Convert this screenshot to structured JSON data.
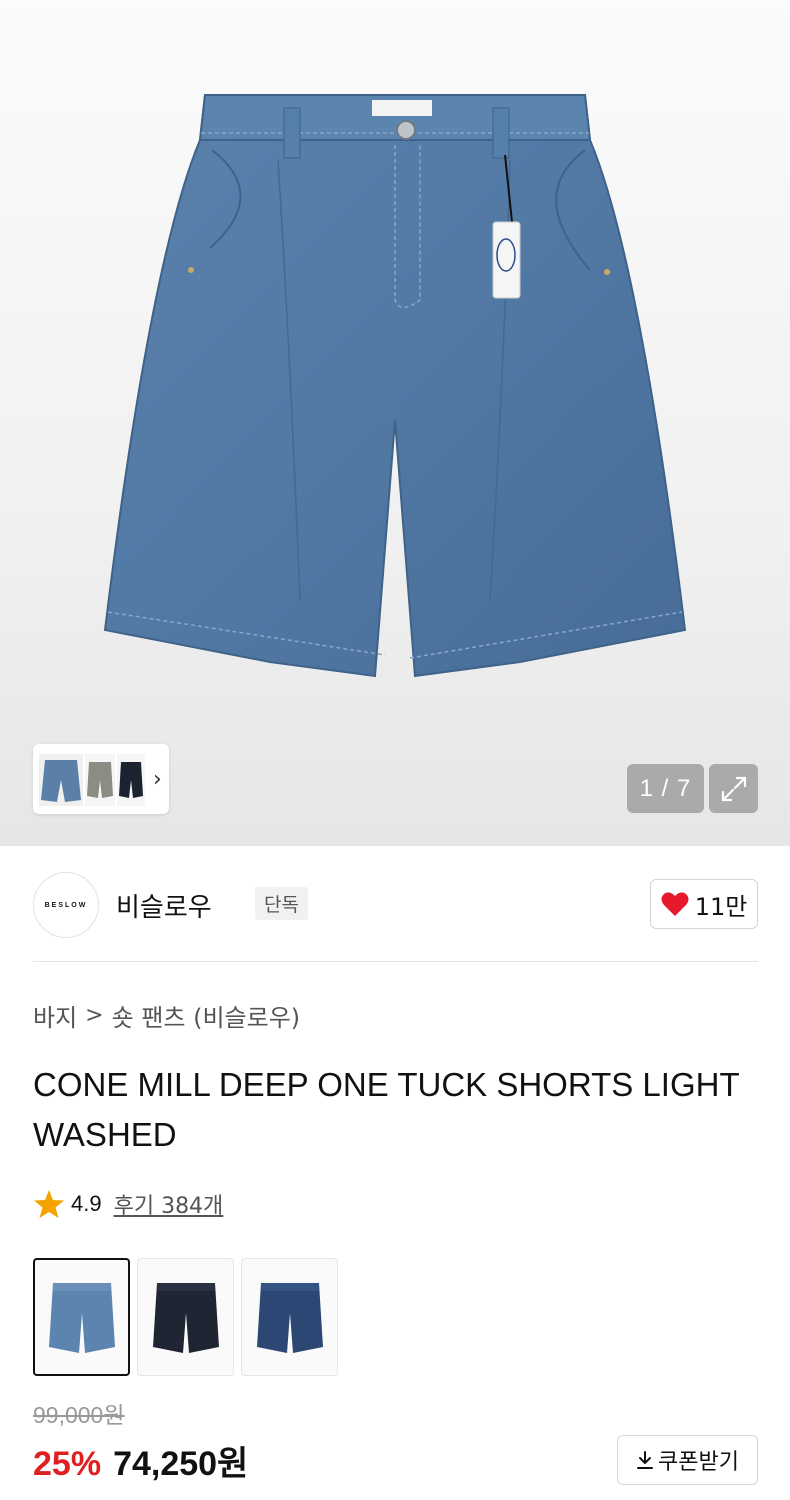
{
  "gallery": {
    "counter": "1 / 7",
    "thumbnail_next_icon": "chevron-right-icon",
    "expand_icon": "expand-icon"
  },
  "brand": {
    "logo_text": "BESLOW",
    "name": "비슬로우",
    "badge": "단독",
    "like_icon": "heart-icon",
    "like_color": "#e8192c",
    "like_count": "11만"
  },
  "breadcrumb": {
    "category": "바지",
    "separator": ">",
    "subcategory": "숏 팬츠 (비슬로우)"
  },
  "product": {
    "title": "CONE MILL DEEP ONE TUCK SHORTS LIGHT WASHED",
    "rating_icon": "star-icon",
    "star_color": "#f5a300",
    "rating": "4.9",
    "review_link": "후기 384개",
    "color_options": [
      {
        "name": "light-wash",
        "color": "#4f78a2",
        "selected": true
      },
      {
        "name": "black",
        "color": "#1f2533",
        "selected": false
      },
      {
        "name": "dark-wash",
        "color": "#2c4774",
        "selected": false
      }
    ]
  },
  "price": {
    "original": "99,000원",
    "discount": "25%",
    "sale": "74,250원",
    "discount_color": "#e02020",
    "coupon_icon": "download-icon",
    "coupon_label": "쿠폰받기"
  }
}
